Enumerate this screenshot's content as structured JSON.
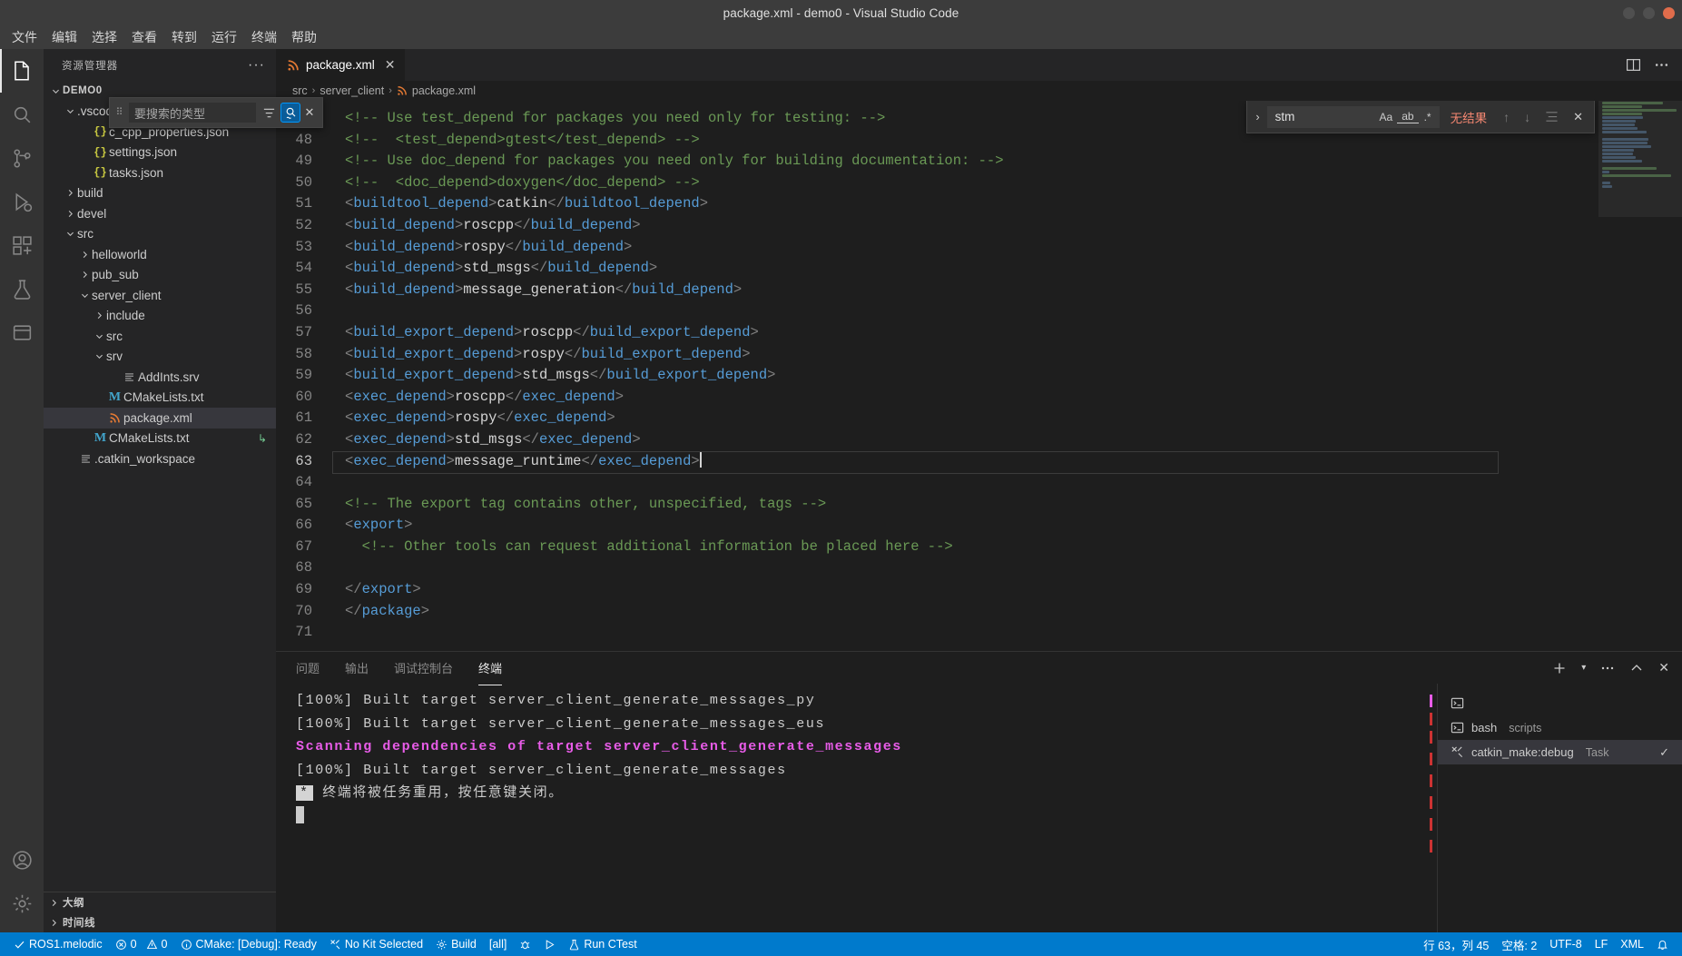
{
  "window": {
    "title": "package.xml - demo0 - Visual Studio Code",
    "buttons": {
      "minimize": "minimize",
      "maximize": "maximize",
      "close": "close"
    }
  },
  "menubar": {
    "items": [
      {
        "label": "文件",
        "name": "menu-file"
      },
      {
        "label": "编辑",
        "name": "menu-edit"
      },
      {
        "label": "选择",
        "name": "menu-selection"
      },
      {
        "label": "查看",
        "name": "menu-view"
      },
      {
        "label": "转到",
        "name": "menu-go"
      },
      {
        "label": "运行",
        "name": "menu-run"
      },
      {
        "label": "终端",
        "name": "menu-terminal"
      },
      {
        "label": "帮助",
        "name": "menu-help"
      }
    ]
  },
  "activitybar": {
    "items": [
      {
        "icon": "files-explorer-icon",
        "active": true
      },
      {
        "icon": "search-icon",
        "active": false
      },
      {
        "icon": "source-control-icon",
        "active": false
      },
      {
        "icon": "run-and-debug-icon",
        "active": false
      },
      {
        "icon": "extensions-icon",
        "active": false
      },
      {
        "icon": "testing-beaker-icon",
        "active": false
      },
      {
        "icon": "ros-box-icon",
        "active": false
      }
    ],
    "bottom": [
      {
        "icon": "account-icon"
      },
      {
        "icon": "settings-gear-icon"
      }
    ]
  },
  "sidebar": {
    "title": "资源管理器",
    "more_actions": "···",
    "search_widget": {
      "placeholder": "要搜索的类型",
      "value": "",
      "filter_icon": "filter-icon",
      "fuzzy_icon": "fuzzy-match-icon",
      "close_icon": "close-icon"
    },
    "tree": [
      {
        "label": "DEMO0",
        "depth": 0,
        "chev": "down",
        "icon": "none",
        "kind": "root"
      },
      {
        "label": ".vscode",
        "depth": 1,
        "chev": "down",
        "icon": "none",
        "kind": "folder"
      },
      {
        "label": "c_cpp_properties.json",
        "depth": 2,
        "chev": "none",
        "icon": "json",
        "kind": "file"
      },
      {
        "label": "settings.json",
        "depth": 2,
        "chev": "none",
        "icon": "json",
        "kind": "file"
      },
      {
        "label": "tasks.json",
        "depth": 2,
        "chev": "none",
        "icon": "json",
        "kind": "file"
      },
      {
        "label": "build",
        "depth": 1,
        "chev": "right",
        "icon": "none",
        "kind": "folder"
      },
      {
        "label": "devel",
        "depth": 1,
        "chev": "right",
        "icon": "none",
        "kind": "folder"
      },
      {
        "label": "src",
        "depth": 1,
        "chev": "down",
        "icon": "none",
        "kind": "folder"
      },
      {
        "label": "helloworld",
        "depth": 2,
        "chev": "right",
        "icon": "none",
        "kind": "folder"
      },
      {
        "label": "pub_sub",
        "depth": 2,
        "chev": "right",
        "icon": "none",
        "kind": "folder"
      },
      {
        "label": "server_client",
        "depth": 2,
        "chev": "down",
        "icon": "none",
        "kind": "folder"
      },
      {
        "label": "include",
        "depth": 3,
        "chev": "right",
        "icon": "none",
        "kind": "folder"
      },
      {
        "label": "src",
        "depth": 3,
        "chev": "down",
        "icon": "none",
        "kind": "folder"
      },
      {
        "label": "srv",
        "depth": 3,
        "chev": "down",
        "icon": "none",
        "kind": "folder"
      },
      {
        "label": "AddInts.srv",
        "depth": 4,
        "chev": "none",
        "icon": "txt",
        "kind": "file"
      },
      {
        "label": "CMakeLists.txt",
        "depth": 3,
        "chev": "none",
        "icon": "m",
        "kind": "file"
      },
      {
        "label": "package.xml",
        "depth": 3,
        "chev": "none",
        "icon": "xml",
        "kind": "file",
        "selected": true
      },
      {
        "label": "CMakeLists.txt",
        "depth": 2,
        "chev": "none",
        "icon": "m",
        "kind": "file",
        "badge": "↳"
      },
      {
        "label": ".catkin_workspace",
        "depth": 1,
        "chev": "none",
        "icon": "txt",
        "kind": "file"
      }
    ],
    "bottom_sections": [
      {
        "label": "大纲",
        "chev": "right"
      },
      {
        "label": "时间线",
        "chev": "right"
      }
    ]
  },
  "editor": {
    "tab": {
      "label": "package.xml",
      "icon": "xml-file-icon",
      "close_icon": "close-icon"
    },
    "actions": {
      "split_icon": "split-editor-icon",
      "more_icon": "more-actions-icon"
    },
    "breadcrumb": [
      "src",
      "server_client",
      "package.xml"
    ],
    "find": {
      "toggle_icon": "chevron-right-icon",
      "value": "stm",
      "match_case": "Aa",
      "whole_word": "ab",
      "regex": ".*",
      "result": "无结果",
      "prev_icon": "arrow-up-icon",
      "next_icon": "arrow-down-icon",
      "selection_icon": "find-in-selection-icon",
      "close_icon": "close-icon"
    },
    "cursor_line": 63,
    "first_line": 47,
    "lines": [
      {
        "n": 47,
        "segs": [
          {
            "t": "cmt",
            "s": "<!-- Use test_depend for packages you need only for testing: -->"
          }
        ]
      },
      {
        "n": 48,
        "segs": [
          {
            "t": "cmt",
            "s": "<!--  <test_depend>gtest</test_depend> -->"
          }
        ]
      },
      {
        "n": 49,
        "segs": [
          {
            "t": "cmt",
            "s": "<!-- Use doc_depend for packages you need only for building documentation: -->"
          }
        ]
      },
      {
        "n": 50,
        "segs": [
          {
            "t": "cmt",
            "s": "<!--  <doc_depend>doxygen</doc_depend> -->"
          }
        ]
      },
      {
        "n": 51,
        "segs": [
          {
            "t": "tagp",
            "s": "<"
          },
          {
            "t": "tag",
            "s": "buildtool_depend"
          },
          {
            "t": "tagp",
            "s": ">"
          },
          {
            "t": "txt",
            "s": "catkin"
          },
          {
            "t": "tagp",
            "s": "</"
          },
          {
            "t": "tag",
            "s": "buildtool_depend"
          },
          {
            "t": "tagp",
            "s": ">"
          }
        ]
      },
      {
        "n": 52,
        "segs": [
          {
            "t": "tagp",
            "s": "<"
          },
          {
            "t": "tag",
            "s": "build_depend"
          },
          {
            "t": "tagp",
            "s": ">"
          },
          {
            "t": "txt",
            "s": "roscpp"
          },
          {
            "t": "tagp",
            "s": "</"
          },
          {
            "t": "tag",
            "s": "build_depend"
          },
          {
            "t": "tagp",
            "s": ">"
          }
        ]
      },
      {
        "n": 53,
        "segs": [
          {
            "t": "tagp",
            "s": "<"
          },
          {
            "t": "tag",
            "s": "build_depend"
          },
          {
            "t": "tagp",
            "s": ">"
          },
          {
            "t": "txt",
            "s": "rospy"
          },
          {
            "t": "tagp",
            "s": "</"
          },
          {
            "t": "tag",
            "s": "build_depend"
          },
          {
            "t": "tagp",
            "s": ">"
          }
        ]
      },
      {
        "n": 54,
        "segs": [
          {
            "t": "tagp",
            "s": "<"
          },
          {
            "t": "tag",
            "s": "build_depend"
          },
          {
            "t": "tagp",
            "s": ">"
          },
          {
            "t": "txt",
            "s": "std_msgs"
          },
          {
            "t": "tagp",
            "s": "</"
          },
          {
            "t": "tag",
            "s": "build_depend"
          },
          {
            "t": "tagp",
            "s": ">"
          }
        ]
      },
      {
        "n": 55,
        "segs": [
          {
            "t": "tagp",
            "s": "<"
          },
          {
            "t": "tag",
            "s": "build_depend"
          },
          {
            "t": "tagp",
            "s": ">"
          },
          {
            "t": "txt",
            "s": "message_generation"
          },
          {
            "t": "tagp",
            "s": "</"
          },
          {
            "t": "tag",
            "s": "build_depend"
          },
          {
            "t": "tagp",
            "s": ">"
          }
        ]
      },
      {
        "n": 56,
        "segs": []
      },
      {
        "n": 57,
        "segs": [
          {
            "t": "tagp",
            "s": "<"
          },
          {
            "t": "tag",
            "s": "build_export_depend"
          },
          {
            "t": "tagp",
            "s": ">"
          },
          {
            "t": "txt",
            "s": "roscpp"
          },
          {
            "t": "tagp",
            "s": "</"
          },
          {
            "t": "tag",
            "s": "build_export_depend"
          },
          {
            "t": "tagp",
            "s": ">"
          }
        ]
      },
      {
        "n": 58,
        "segs": [
          {
            "t": "tagp",
            "s": "<"
          },
          {
            "t": "tag",
            "s": "build_export_depend"
          },
          {
            "t": "tagp",
            "s": ">"
          },
          {
            "t": "txt",
            "s": "rospy"
          },
          {
            "t": "tagp",
            "s": "</"
          },
          {
            "t": "tag",
            "s": "build_export_depend"
          },
          {
            "t": "tagp",
            "s": ">"
          }
        ]
      },
      {
        "n": 59,
        "segs": [
          {
            "t": "tagp",
            "s": "<"
          },
          {
            "t": "tag",
            "s": "build_export_depend"
          },
          {
            "t": "tagp",
            "s": ">"
          },
          {
            "t": "txt",
            "s": "std_msgs"
          },
          {
            "t": "tagp",
            "s": "</"
          },
          {
            "t": "tag",
            "s": "build_export_depend"
          },
          {
            "t": "tagp",
            "s": ">"
          }
        ]
      },
      {
        "n": 60,
        "segs": [
          {
            "t": "tagp",
            "s": "<"
          },
          {
            "t": "tag",
            "s": "exec_depend"
          },
          {
            "t": "tagp",
            "s": ">"
          },
          {
            "t": "txt",
            "s": "roscpp"
          },
          {
            "t": "tagp",
            "s": "</"
          },
          {
            "t": "tag",
            "s": "exec_depend"
          },
          {
            "t": "tagp",
            "s": ">"
          }
        ]
      },
      {
        "n": 61,
        "segs": [
          {
            "t": "tagp",
            "s": "<"
          },
          {
            "t": "tag",
            "s": "exec_depend"
          },
          {
            "t": "tagp",
            "s": ">"
          },
          {
            "t": "txt",
            "s": "rospy"
          },
          {
            "t": "tagp",
            "s": "</"
          },
          {
            "t": "tag",
            "s": "exec_depend"
          },
          {
            "t": "tagp",
            "s": ">"
          }
        ]
      },
      {
        "n": 62,
        "segs": [
          {
            "t": "tagp",
            "s": "<"
          },
          {
            "t": "tag",
            "s": "exec_depend"
          },
          {
            "t": "tagp",
            "s": ">"
          },
          {
            "t": "txt",
            "s": "std_msgs"
          },
          {
            "t": "tagp",
            "s": "</"
          },
          {
            "t": "tag",
            "s": "exec_depend"
          },
          {
            "t": "tagp",
            "s": ">"
          }
        ]
      },
      {
        "n": 63,
        "segs": [
          {
            "t": "tagp",
            "s": "<"
          },
          {
            "t": "tag",
            "s": "exec_depend"
          },
          {
            "t": "tagp",
            "s": ">"
          },
          {
            "t": "txt",
            "s": "message_runtime"
          },
          {
            "t": "tagp",
            "s": "</"
          },
          {
            "t": "tag",
            "s": "exec_depend"
          },
          {
            "t": "tagp",
            "s": ">"
          }
        ],
        "current": true
      },
      {
        "n": 64,
        "segs": []
      },
      {
        "n": 65,
        "segs": [
          {
            "t": "cmt",
            "s": "<!-- The export tag contains other, unspecified, tags -->"
          }
        ]
      },
      {
        "n": 66,
        "segs": [
          {
            "t": "tagp",
            "s": "<"
          },
          {
            "t": "tag",
            "s": "export"
          },
          {
            "t": "tagp",
            "s": ">"
          }
        ]
      },
      {
        "n": 67,
        "segs": [
          {
            "t": "cmt",
            "s": "  <!-- Other tools can request additional information be placed here -->"
          }
        ]
      },
      {
        "n": 68,
        "segs": []
      },
      {
        "n": 69,
        "segs": [
          {
            "t": "tagp",
            "s": "</"
          },
          {
            "t": "tag",
            "s": "export"
          },
          {
            "t": "tagp",
            "s": ">"
          }
        ]
      },
      {
        "n": 70,
        "segs": [
          {
            "t": "tagp",
            "s": "</"
          },
          {
            "t": "tag",
            "s": "package"
          },
          {
            "t": "tagp",
            "s": ">"
          }
        ]
      },
      {
        "n": 71,
        "segs": []
      }
    ]
  },
  "panel": {
    "tabs": [
      {
        "label": "问题",
        "active": false
      },
      {
        "label": "输出",
        "active": false
      },
      {
        "label": "调试控制台",
        "active": false
      },
      {
        "label": "终端",
        "active": true
      }
    ],
    "actions": {
      "new_terminal_icon": "plus-icon",
      "terminal_dropdown_icon": "chevron-down-icon",
      "more_icon": "more-actions-icon",
      "maximize_icon": "chevron-up-icon",
      "close_icon": "close-icon"
    },
    "terminal_lines": [
      {
        "text": "[100%] Built target server_client_generate_messages_py",
        "style": "normal"
      },
      {
        "text": "[100%] Built target server_client_generate_messages_eus",
        "style": "normal"
      },
      {
        "text": "Scanning dependencies of target server_client_generate_messages",
        "style": "magenta"
      },
      {
        "text": "[100%] Built target server_client_generate_messages",
        "style": "normal"
      },
      {
        "text": "终端将被任务重用，按任意键关闭。",
        "style": "notice",
        "prefix": "*"
      }
    ],
    "tasks": [
      {
        "label": "",
        "sub": "",
        "icon": "terminal-icon",
        "selected": false
      },
      {
        "label": "bash",
        "sub": "scripts",
        "icon": "terminal-icon",
        "selected": false
      },
      {
        "label": "catkin_make:debug",
        "sub": "Task",
        "icon": "tools-icon",
        "selected": true,
        "check": "✓"
      }
    ]
  },
  "statusbar": {
    "left": [
      {
        "icon": "check-icon",
        "label": "ROS1.melodic",
        "name": "status-ros-distro"
      },
      {
        "icon": "error-icon",
        "label": "0",
        "icon2": "warning-icon",
        "label2": "0",
        "name": "status-problems"
      },
      {
        "icon": "info-icon",
        "label": "CMake: [Debug]: Ready",
        "name": "status-cmake"
      },
      {
        "icon": "kit-icon",
        "label": "No Kit Selected",
        "name": "status-kit"
      },
      {
        "icon": "gear-icon",
        "label": "Build",
        "name": "status-build"
      },
      {
        "icon": "none",
        "label": "[all]",
        "name": "status-target"
      },
      {
        "icon": "debug-icon",
        "label": "",
        "name": "status-debug"
      },
      {
        "icon": "play-icon",
        "label": "",
        "name": "status-run"
      },
      {
        "icon": "beaker-icon",
        "label": "Run CTest",
        "name": "status-ctest"
      }
    ],
    "right": [
      {
        "label": "行 63，列 45",
        "name": "status-cursor-position"
      },
      {
        "label": "空格: 2",
        "name": "status-indentation"
      },
      {
        "label": "UTF-8",
        "name": "status-encoding"
      },
      {
        "label": "LF",
        "name": "status-eol"
      },
      {
        "label": "XML",
        "name": "status-language-mode"
      },
      {
        "label": "",
        "icon": "bell-icon",
        "name": "status-notifications"
      }
    ]
  }
}
